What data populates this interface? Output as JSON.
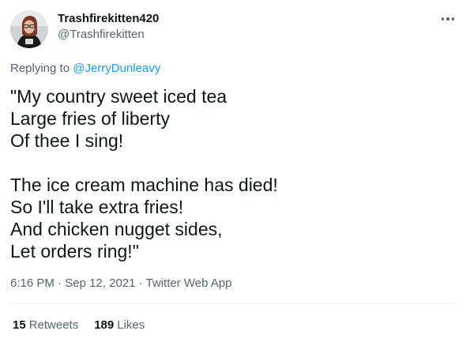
{
  "tweet": {
    "author": {
      "display_name": "Trashfirekitten420",
      "handle": "@Trashfirekitten"
    },
    "reply": {
      "prefix": "Replying to ",
      "mention": "@JerryDunleavy"
    },
    "text_lines": [
      "\"My country sweet iced tea",
      "Large fries of liberty",
      "Of thee I sing!",
      "",
      "The ice cream machine has died!",
      "So I'll take extra fries!",
      "And chicken nugget sides,",
      "Let orders ring!\""
    ],
    "meta": {
      "time": "6:16 PM",
      "separator": " · ",
      "date": "Sep 12, 2021",
      "source": "Twitter Web App"
    },
    "stats": {
      "retweets_count": "15",
      "retweets_label": "Retweets",
      "likes_count": "189",
      "likes_label": "Likes"
    }
  },
  "colors": {
    "text": "#0f1419",
    "secondary": "#536471",
    "link": "#1d9bf0",
    "divider": "#eff3f4"
  },
  "icons": {
    "more": "more-horizontal-icon",
    "avatar": "avatar-image"
  }
}
